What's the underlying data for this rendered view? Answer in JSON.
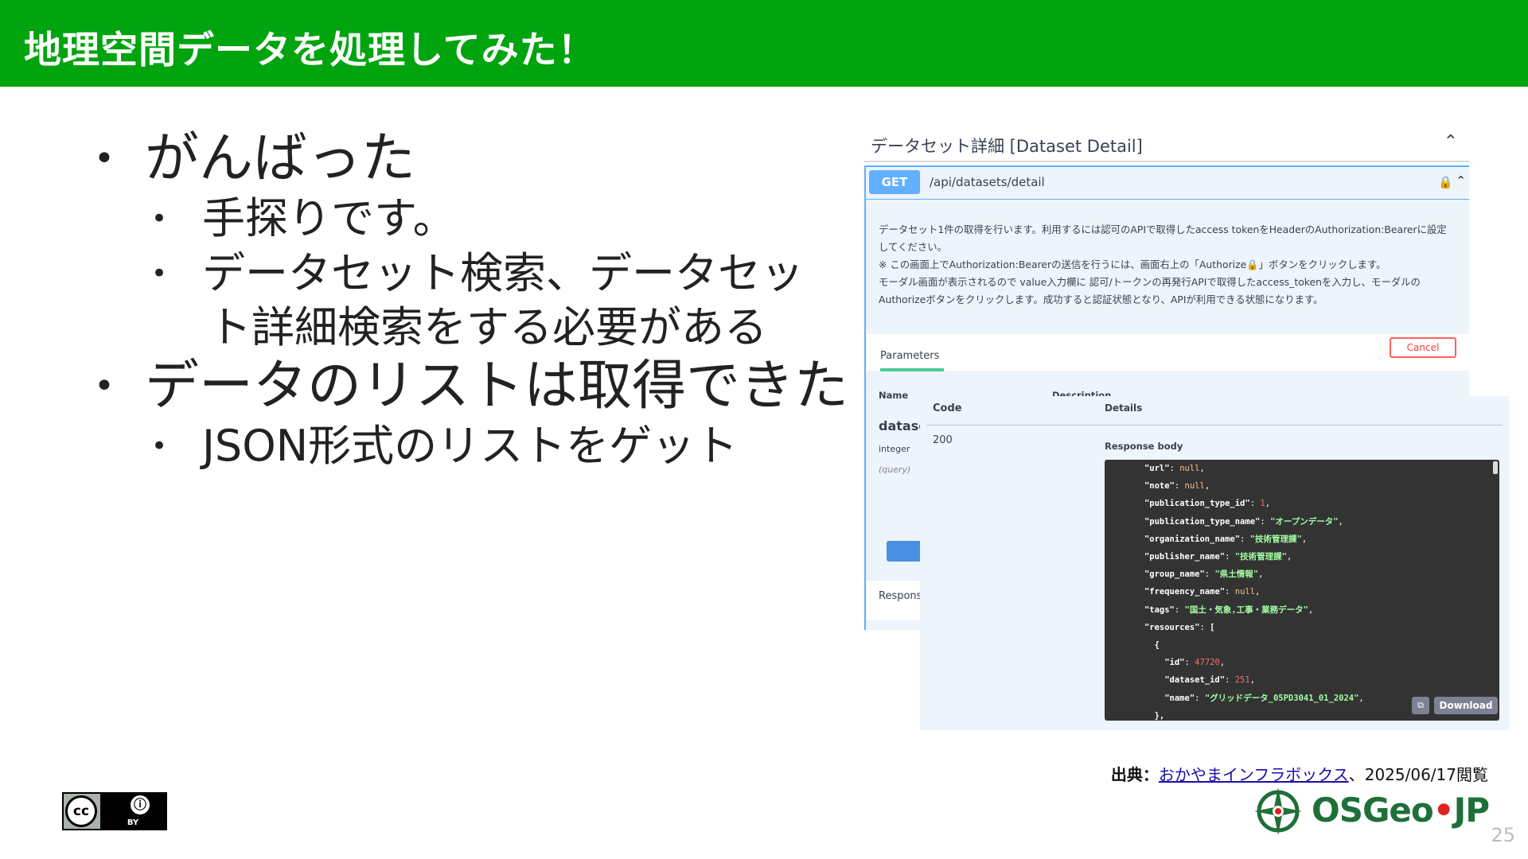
{
  "slide": {
    "title": "地理空間データを処理してみた！",
    "page_number": "25"
  },
  "bullets": {
    "b1": "がんばった",
    "b1_1": "手探りです。",
    "b1_2_line1": "データセット検索、データセッ",
    "b1_2_line2": "ト詳細検索をする必要がある",
    "b2": "データのリストは取得できた",
    "b2_1": "JSON形式のリストをゲット"
  },
  "swagger": {
    "section_title": "データセット詳細 [Dataset Detail]",
    "method": "GET",
    "path": "/api/datasets/detail",
    "desc_lines": [
      "データセット1件の取得を行います。利用するには認可のAPIで取得したaccess tokenをHeaderのAuthorization:Bearerに設定",
      "してください。",
      "※ この画面上でAuthorization:Bearerの送信を行うには、画面右上の「Authorize🔒」ボタンをクリックします。",
      "モーダル画面が表示されるので value入力欄に 認可/トークンの再発行APIで取得したaccess_tokenを入力し、モーダルの",
      "Authorizeボタンをクリックします。成功すると認証状態となり、APIが利用できる状態になります。"
    ],
    "params_tab": "Parameters",
    "cancel_label": "Cancel",
    "col_name": "Name",
    "col_description": "Description",
    "param_name": "datase",
    "param_type": "integer",
    "param_in": "(query)",
    "responses_label": "Respons"
  },
  "response": {
    "col_code": "Code",
    "col_details": "Details",
    "code": "200",
    "body_label": "Response body",
    "download_label": "Download",
    "lines": [
      {
        "indent": "      ",
        "key": "\"url\"",
        "val": "null",
        "vtype": "nl"
      },
      {
        "indent": "      ",
        "key": "\"note\"",
        "val": "null",
        "vtype": "nl"
      },
      {
        "indent": "      ",
        "key": "\"publication_type_id\"",
        "val": "1",
        "vtype": "n"
      },
      {
        "indent": "      ",
        "key": "\"publication_type_name\"",
        "val": "\"オープンデータ\"",
        "vtype": "s"
      },
      {
        "indent": "      ",
        "key": "\"organization_name\"",
        "val": "\"技術管理課\"",
        "vtype": "s"
      },
      {
        "indent": "      ",
        "key": "\"publisher_name\"",
        "val": "\"技術管理課\"",
        "vtype": "s"
      },
      {
        "indent": "      ",
        "key": "\"group_name\"",
        "val": "\"県土情報\"",
        "vtype": "s"
      },
      {
        "indent": "      ",
        "key": "\"frequency_name\"",
        "val": "null",
        "vtype": "nl"
      },
      {
        "indent": "      ",
        "key": "\"tags\"",
        "val": "\"国土・気象,工事・業務データ\"",
        "vtype": "s"
      },
      {
        "indent": "      ",
        "key": "\"resources\"",
        "val": "[",
        "vtype": "k"
      },
      {
        "indent": "        ",
        "key": "",
        "val": "{",
        "vtype": "k"
      },
      {
        "indent": "          ",
        "key": "\"id\"",
        "val": "47720",
        "vtype": "n"
      },
      {
        "indent": "          ",
        "key": "\"dataset_id\"",
        "val": "251",
        "vtype": "n"
      },
      {
        "indent": "          ",
        "key": "\"name\"",
        "val": "\"グリッドデータ_05PD3041_01_2024\"",
        "vtype": "s"
      },
      {
        "indent": "        ",
        "key": "",
        "val": "},",
        "vtype": "k"
      }
    ]
  },
  "source": {
    "label": "出典：",
    "link_text": "おかやまインフラボックス",
    "suffix": "、2025/06/17閲覧"
  },
  "license": {
    "cc": "cc",
    "by": "BY"
  },
  "logo": {
    "text_left": "OSGeo",
    "dot": "•",
    "text_right": "JP"
  },
  "colors": {
    "header": "#00a40f",
    "get": "#61affe",
    "cancel": "#ff6060",
    "code_bg": "#333333"
  }
}
